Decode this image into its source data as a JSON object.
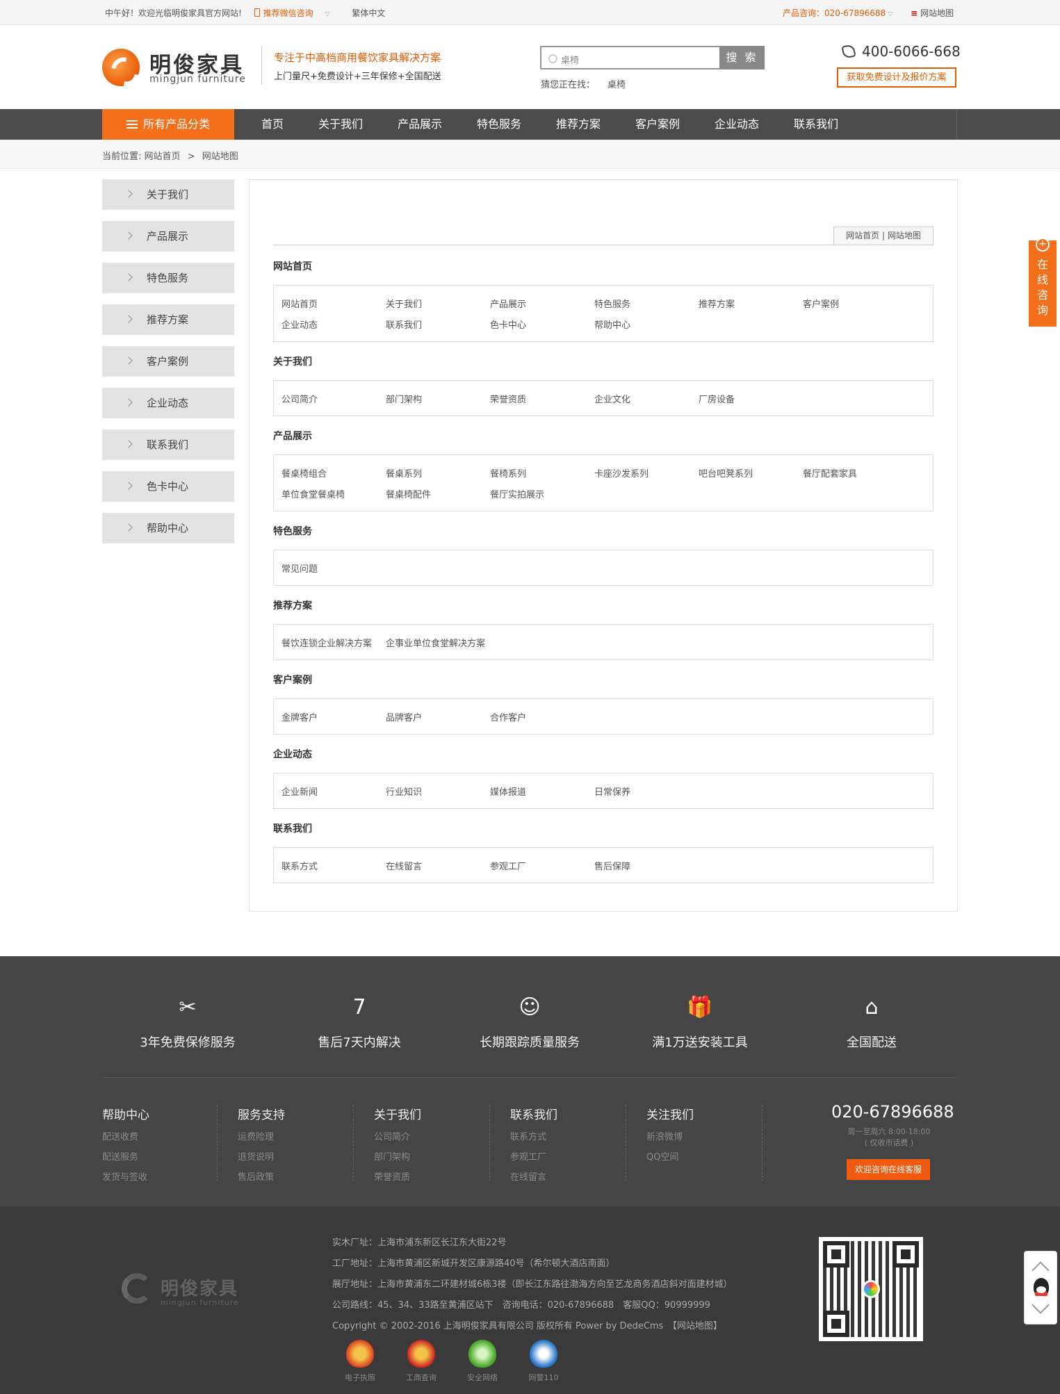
{
  "topbar": {
    "welcome": "中午好！欢迎光临明俊家具官方网站!",
    "wechat": "推荐微信咨询",
    "trad": "繁体中文",
    "hotline": "产品咨询：020-67896688",
    "sitemap": "网站地图"
  },
  "header": {
    "logo_cn": "明俊家具",
    "logo_en": "mingjun furniture",
    "slogan1": "专注于中高档商用餐饮家具解决方案",
    "slogan2": "上门量尺+免费设计+三年保修+全国配送",
    "search_placeholder": "桌椅",
    "search_button": "搜 索",
    "guess_label": "猜您正在找：",
    "guess_value": "桌椅",
    "phone": "400-6066-668",
    "quote_button": "获取免费设计及报价方案"
  },
  "nav": {
    "all": "所有产品分类",
    "items": [
      "首页",
      "关于我们",
      "产品展示",
      "特色服务",
      "推荐方案",
      "客户案例",
      "企业动态",
      "联系我们"
    ]
  },
  "breadcrumb": {
    "label": "当前位置:",
    "home": "网站首页",
    "sep": ">",
    "current": "网站地图"
  },
  "sidebar": [
    "关于我们",
    "产品展示",
    "特色服务",
    "推荐方案",
    "客户案例",
    "企业动态",
    "联系我们",
    "色卡中心",
    "帮助中心"
  ],
  "main": {
    "crumb": "网站首页 | 网站地图",
    "sections": [
      {
        "title": "网站首页",
        "links": [
          "网站首页",
          "关于我们",
          "产品展示",
          "特色服务",
          "推荐方案",
          "客户案例",
          "企业动态",
          "联系我们",
          "色卡中心",
          "帮助中心"
        ]
      },
      {
        "title": "关于我们",
        "links": [
          "公司简介",
          "部门架构",
          "荣誉资质",
          "企业文化",
          "厂房设备"
        ]
      },
      {
        "title": "产品展示",
        "links": [
          "餐桌椅组合",
          "餐桌系列",
          "餐椅系列",
          "卡座沙发系列",
          "吧台吧凳系列",
          "餐厅配套家具",
          "单位食堂餐桌椅",
          "餐桌椅配件",
          "餐厅实拍展示"
        ]
      },
      {
        "title": "特色服务",
        "links": [
          "常见问题"
        ]
      },
      {
        "title": "推荐方案",
        "links": [
          "餐饮连锁企业解决方案",
          "企事业单位食堂解决方案"
        ]
      },
      {
        "title": "客户案例",
        "links": [
          "金牌客户",
          "品牌客户",
          "合作客户"
        ]
      },
      {
        "title": "企业动态",
        "links": [
          "企业新闻",
          "行业知识",
          "媒体报道",
          "日常保养"
        ]
      },
      {
        "title": "联系我们",
        "links": [
          "联系方式",
          "在线留言",
          "参观工厂",
          "售后保障"
        ]
      }
    ]
  },
  "services": [
    {
      "icon": "tools-icon",
      "glyph": "✂",
      "label": "3年免费保修服务"
    },
    {
      "icon": "seven-icon",
      "glyph": "7",
      "label": "售后7天内解决"
    },
    {
      "icon": "support-icon",
      "glyph": "☺",
      "label": "长期跟踪质量服务"
    },
    {
      "icon": "gift-icon",
      "glyph": "🎁",
      "label": "满1万送安装工具"
    },
    {
      "icon": "delivery-icon",
      "glyph": "⌂",
      "label": "全国配送"
    }
  ],
  "footer_cols": [
    {
      "title": "帮助中心",
      "links": [
        "配送收费",
        "配送服务",
        "发货与签收"
      ]
    },
    {
      "title": "服务支持",
      "links": [
        "运费险理",
        "退货说明",
        "售后政策"
      ]
    },
    {
      "title": "关于我们",
      "links": [
        "公司简介",
        "部门架构",
        "荣誉资质"
      ]
    },
    {
      "title": "联系我们",
      "links": [
        "联系方式",
        "参观工厂",
        "在线留言"
      ]
    },
    {
      "title": "关注我们",
      "links": [
        "新浪微博",
        "QQ空间"
      ]
    }
  ],
  "footer_contact": {
    "phone": "020-67896688",
    "hours1": "周一至周六 8:00-18:00",
    "hours2": "( 仅收市话费 )",
    "button": "欢迎咨询在线客服"
  },
  "footer_info": [
    "实木厂址：上海市浦东新区长江东大街22号",
    "工厂地址：上海市黄浦区新城开发区康源路40号（希尔顿大酒店南面）",
    "展厅地址：上海市黄浦东二环建材城6栋3楼（即长江东路往渤海方向至艺龙商务酒店斜对面建材城）",
    "公司路线：45、34、33路至黄浦区站下　咨询电话：020-67896688　客服QQ：90999999",
    "Copyright © 2002-2016 上海明俊家具有限公司 版权所有 Power by DedeCms　【网站地图】"
  ],
  "badges": [
    {
      "label": "电子执照",
      "color": "#d83a1e"
    },
    {
      "label": "工商查询",
      "color": "#cc2222"
    },
    {
      "label": "安全网络",
      "color": "#4aa82a"
    },
    {
      "label": "网警110",
      "color": "#2a78c8"
    }
  ],
  "consult": "在线咨询",
  "colors": {
    "accent": "#f36f1a",
    "nav_bg": "#4b4b4b",
    "footer_bg": "#454545"
  }
}
